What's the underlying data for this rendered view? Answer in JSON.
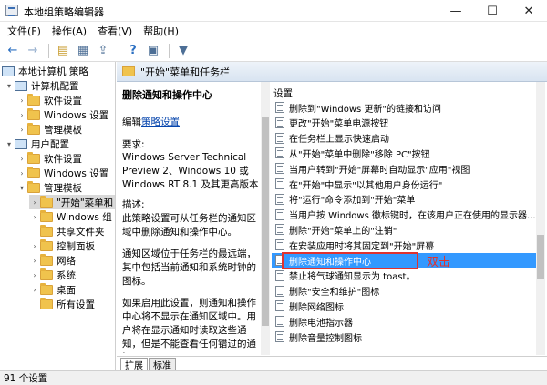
{
  "window": {
    "title": "本地组策略编辑器",
    "minimize": "—",
    "maximize": "☐",
    "close": "✕"
  },
  "menu": [
    "文件(F)",
    "操作(A)",
    "查看(V)",
    "帮助(H)"
  ],
  "toolbar": {
    "back": "←",
    "forward": "→",
    "up": "▤",
    "tree": "▦",
    "export": "⇪",
    "help": "?",
    "props": "▣",
    "filter": "▼"
  },
  "tree": {
    "root": "本地计算机 策略",
    "computer_config": "计算机配置",
    "cc_software": "软件设置",
    "cc_windows": "Windows 设置",
    "cc_admin": "管理模板",
    "user_config": "用户配置",
    "uc_software": "软件设置",
    "uc_windows": "Windows 设置",
    "uc_admin": "管理模板",
    "start_menu": "\"开始\"菜单和",
    "windows_comp": "Windows 组",
    "shared": "共享文件夹",
    "control": "控制面板",
    "network": "网络",
    "system": "系统",
    "desktop": "桌面",
    "all": "所有设置"
  },
  "header": "\"开始\"菜单和任务栏",
  "description": {
    "title": "删除通知和操作中心",
    "edit_prefix": "编辑",
    "edit_link": "策略设置",
    "req_label": "要求:",
    "req_text": "Windows Server Technical Preview 2、Windows 10 或 Windows RT 8.1 及其更高版本",
    "desc_label": "描述:",
    "desc_text": "此策略设置可从任务栏的通知区域中删除通知和操作中心。",
    "desc_text2": "通知区域位于任务栏的最远端，其中包括当前通知和系统时钟的图标。",
    "desc_text3": "如果启用此设置，则通知和操作中心将不显示在通知区域中。用户将在显示通知时读取这些通知，但是不能查看任何错过的通知。"
  },
  "list": {
    "header": "设置",
    "rows": [
      "删除到\"Windows 更新\"的链接和访问",
      "更改\"开始\"菜单电源按钮",
      "在任务栏上显示快速启动",
      "从\"开始\"菜单中删除\"移除 PC\"按钮",
      "当用户转到\"开始\"屏幕时自动显示\"应用\"视图",
      "在\"开始\"中显示\"以其他用户身份运行\"",
      "将\"运行\"命令添加到\"开始\"菜单",
      "当用户按 Windows 徽标键时，在该用户正在使用的显示器...",
      "删除\"开始\"菜单上的\"注销\"",
      "在安装应用时将其固定到\"开始\"屏幕",
      "删除通知和操作中心",
      "禁止将气球通知显示为 toast。",
      "删除\"安全和维护\"图标",
      "删除网络图标",
      "删除电池指示器",
      "删除音量控制图标"
    ],
    "selected_index": 10,
    "annotation": "双击"
  },
  "tabs": [
    "扩展",
    "标准"
  ],
  "status": "91 个设置"
}
